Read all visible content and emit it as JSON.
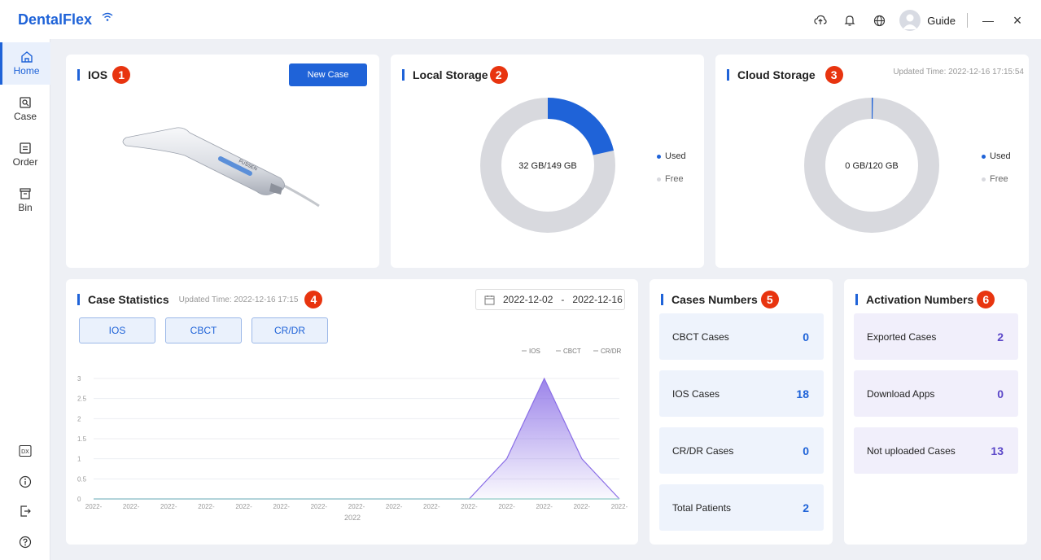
{
  "app": {
    "title": "DentalFlex",
    "user": "Guide"
  },
  "window_controls": {
    "minimize": "—",
    "close": "×"
  },
  "sidebar": {
    "items": [
      {
        "label": "Home",
        "icon": "home-icon",
        "active": true
      },
      {
        "label": "Case",
        "icon": "case-icon"
      },
      {
        "label": "Order",
        "icon": "order-icon"
      },
      {
        "label": "Bin",
        "icon": "bin-icon"
      }
    ],
    "bottom_icons": [
      "dx-icon",
      "info-icon",
      "logout-icon",
      "help-icon"
    ],
    "dx_label": "DX"
  },
  "ios_card": {
    "title": "IOS",
    "badge": "1",
    "new_case_label": "New Case",
    "device_brand": "FUSSEN"
  },
  "local_storage": {
    "title": "Local Storage",
    "badge": "2",
    "center_text": "32 GB/149 GB",
    "used_fraction": 0.2148,
    "legend_used": "Used",
    "legend_free": "Free"
  },
  "cloud_storage": {
    "title": "Cloud Storage",
    "badge": "3",
    "updated": "Updated Time: 2022-12-16 17:15:54",
    "center_text": "0 GB/120 GB",
    "used_fraction": 0.003,
    "legend_used": "Used",
    "legend_free": "Free"
  },
  "case_statistics": {
    "title": "Case Statistics",
    "badge": "4",
    "updated": "Updated Time: 2022-12-16 17:15",
    "date_start": "2022-12-02",
    "date_sep": "-",
    "date_end": "2022-12-16",
    "tabs": [
      "IOS",
      "CBCT",
      "CR/DR"
    ],
    "xlabel": "2022"
  },
  "cases_numbers": {
    "title": "Cases Numbers",
    "badge": "5",
    "items": [
      {
        "label": "CBCT Cases",
        "value": "0"
      },
      {
        "label": "IOS Cases",
        "value": "18"
      },
      {
        "label": "CR/DR Cases",
        "value": "0"
      },
      {
        "label": "Total Patients",
        "value": "2"
      }
    ]
  },
  "activation_numbers": {
    "title": "Activation Numbers",
    "badge": "6",
    "items": [
      {
        "label": "Exported Cases",
        "value": "2"
      },
      {
        "label": "Download Apps",
        "value": "0"
      },
      {
        "label": "Not uploaded Cases",
        "value": "13"
      }
    ]
  },
  "colors": {
    "accent": "#1f63d8",
    "badge": "#e8340f",
    "purple": "#8a6ee6",
    "donut_free": "#d8d9de"
  },
  "chart_data": {
    "type": "area",
    "categories": [
      "2022-",
      "2022-",
      "2022-",
      "2022-",
      "2022-",
      "2022-",
      "2022-",
      "2022-",
      "2022-",
      "2022-",
      "2022-",
      "2022-",
      "2022-",
      "2022-",
      "2022-"
    ],
    "xlabel": "2022",
    "ylim": [
      0,
      3
    ],
    "yticks": [
      "0",
      "0.5",
      "1",
      "1.5",
      "2",
      "2.5",
      "3"
    ],
    "series": [
      {
        "name": "IOS",
        "values": [
          0,
          0,
          0,
          0,
          0,
          0,
          0,
          0,
          0,
          0,
          0,
          1,
          3,
          1,
          0
        ],
        "color": "#8a6ee6"
      },
      {
        "name": "CBCT",
        "values": [
          0,
          0,
          0,
          0,
          0,
          0,
          0,
          0,
          0,
          0,
          0,
          0,
          0,
          0,
          0
        ],
        "color": "#9aa3b5"
      },
      {
        "name": "CR/DR",
        "values": [
          0,
          0,
          0,
          0,
          0,
          0,
          0,
          0,
          0,
          0,
          0,
          0,
          0,
          0,
          0
        ],
        "color": "#9fd8d2"
      }
    ],
    "legend": [
      "IOS",
      "CBCT",
      "CR/DR"
    ],
    "legend_position": "top-right",
    "grid": true
  }
}
